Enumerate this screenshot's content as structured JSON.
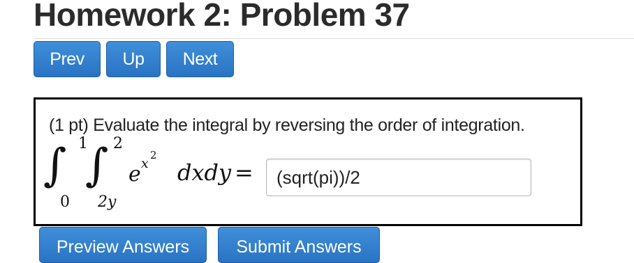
{
  "header": {
    "title": "Homework 2: Problem 37"
  },
  "nav": {
    "prev": "Prev",
    "up": "Up",
    "next": "Next"
  },
  "problem": {
    "statement": "(1 pt) Evaluate the integral by reversing the order of integration.",
    "math": {
      "outer_lower": "0",
      "outer_upper": "1",
      "inner_lower": "2y",
      "inner_upper": "2",
      "integrand_base": "e",
      "integrand_exp": "x",
      "integrand_exp_power": "2",
      "differentials": "dxdy",
      "equals": "="
    },
    "answer_value": "(sqrt(pi))/2"
  },
  "actions": {
    "preview": "Preview Answers",
    "submit": "Submit Answers"
  }
}
